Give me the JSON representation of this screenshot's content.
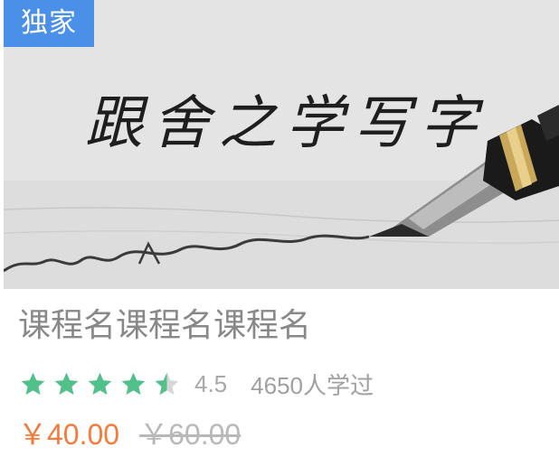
{
  "course": {
    "badge": "独家",
    "banner_title": "跟舍之学写字",
    "title": "课程名课程名课程名",
    "rating": 4.5,
    "rating_text": "4.5",
    "learners": "4650人学过",
    "price_current": "￥40.00",
    "price_original": "￥60.00"
  },
  "colors": {
    "badge_bg": "#4a90e8",
    "star": "#52c08a",
    "price_current": "#f57a3c",
    "title": "#888888",
    "muted": "#a8a8a8"
  },
  "icons": {
    "star": "star-icon",
    "pen": "fountain-pen-illustration"
  }
}
